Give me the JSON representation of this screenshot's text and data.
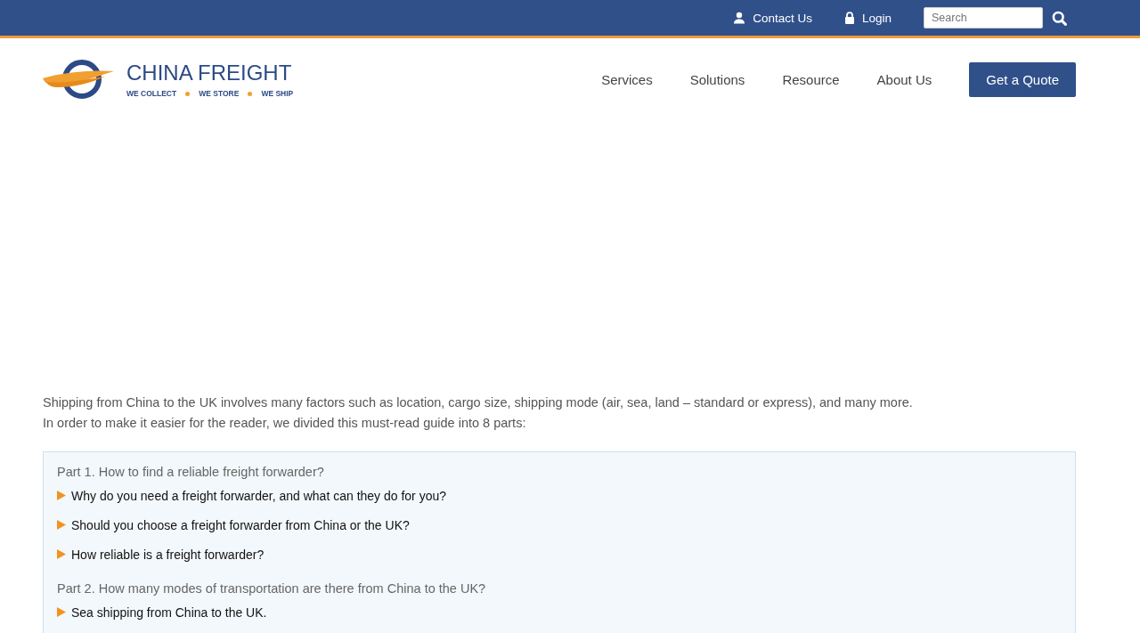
{
  "top_bar": {
    "contact": "Contact Us",
    "login": "Login",
    "search": {
      "placeholder": "Search"
    }
  },
  "logo": {
    "name": "CHINA FREIGHT",
    "taglines": [
      "WE COLLECT",
      "WE STORE",
      "WE SHIP"
    ]
  },
  "nav": {
    "items": [
      "Services",
      "Solutions",
      "Resource",
      "About Us"
    ],
    "cta": "Get a Quote"
  },
  "intro": [
    "Shipping from China to the UK involves many factors such as location, cargo size, shipping mode (air, sea, land – standard or express), and many more.",
    "In order to make it easier for the reader, we divided this must-read guide into 8 parts:"
  ],
  "toc": [
    {
      "title": "Part 1. How to find a reliable freight forwarder?",
      "children": [
        "Why do you need a freight forwarder, and what can they do for you?",
        "Should you choose a freight forwarder from China or the UK?",
        "How reliable is a freight forwarder?"
      ]
    },
    {
      "title": "Part 2. How many modes of transportation are there from China to the UK?",
      "children": [
        "Sea shipping from China to the UK."
      ]
    }
  ]
}
